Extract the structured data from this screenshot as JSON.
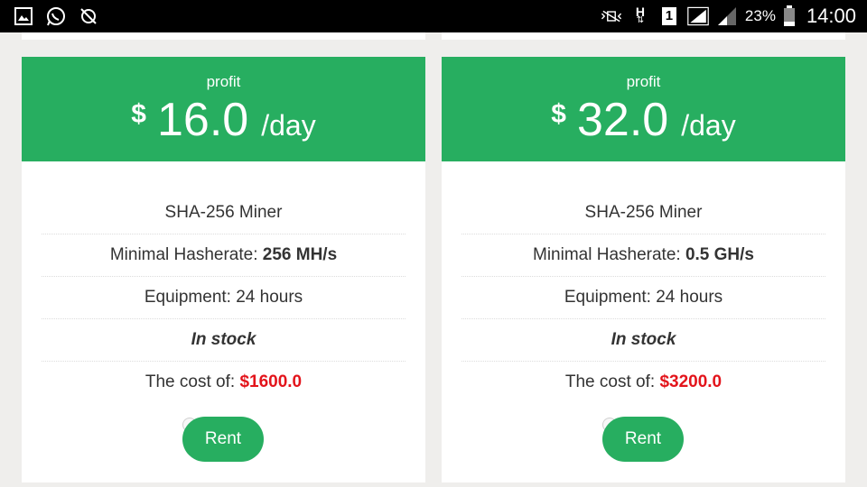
{
  "statusbar": {
    "battery": "23%",
    "time": "14:00",
    "network": "H",
    "sim": "1",
    "icons": [
      "gallery-icon",
      "whatsapp-icon",
      "sync-off-icon",
      "mute-vibrate-icon",
      "network-h-icon",
      "sim-1-icon",
      "signal-icon",
      "signal-2-icon",
      "battery-icon"
    ]
  },
  "colors": {
    "accent": "#27ae60",
    "cost": "#e3141b"
  },
  "cards": [
    {
      "profit_label": "profit",
      "currency": "$",
      "amount": "16.0",
      "per": "/day",
      "algorithm": "SHA-256 Miner",
      "hashrate_label": "Minimal Hasherate:",
      "hashrate_value": "256 MH/s",
      "equipment": "Equipment: 24 hours",
      "stock": "In stock",
      "cost_label": "The cost of:",
      "cost_value": "$1600.0",
      "button": "Rent"
    },
    {
      "profit_label": "profit",
      "currency": "$",
      "amount": "32.0",
      "per": "/day",
      "algorithm": "SHA-256 Miner",
      "hashrate_label": "Minimal Hasherate:",
      "hashrate_value": "0.5 GH/s",
      "equipment": "Equipment: 24 hours",
      "stock": "In stock",
      "cost_label": "The cost of:",
      "cost_value": "$3200.0",
      "button": "Rent"
    }
  ]
}
